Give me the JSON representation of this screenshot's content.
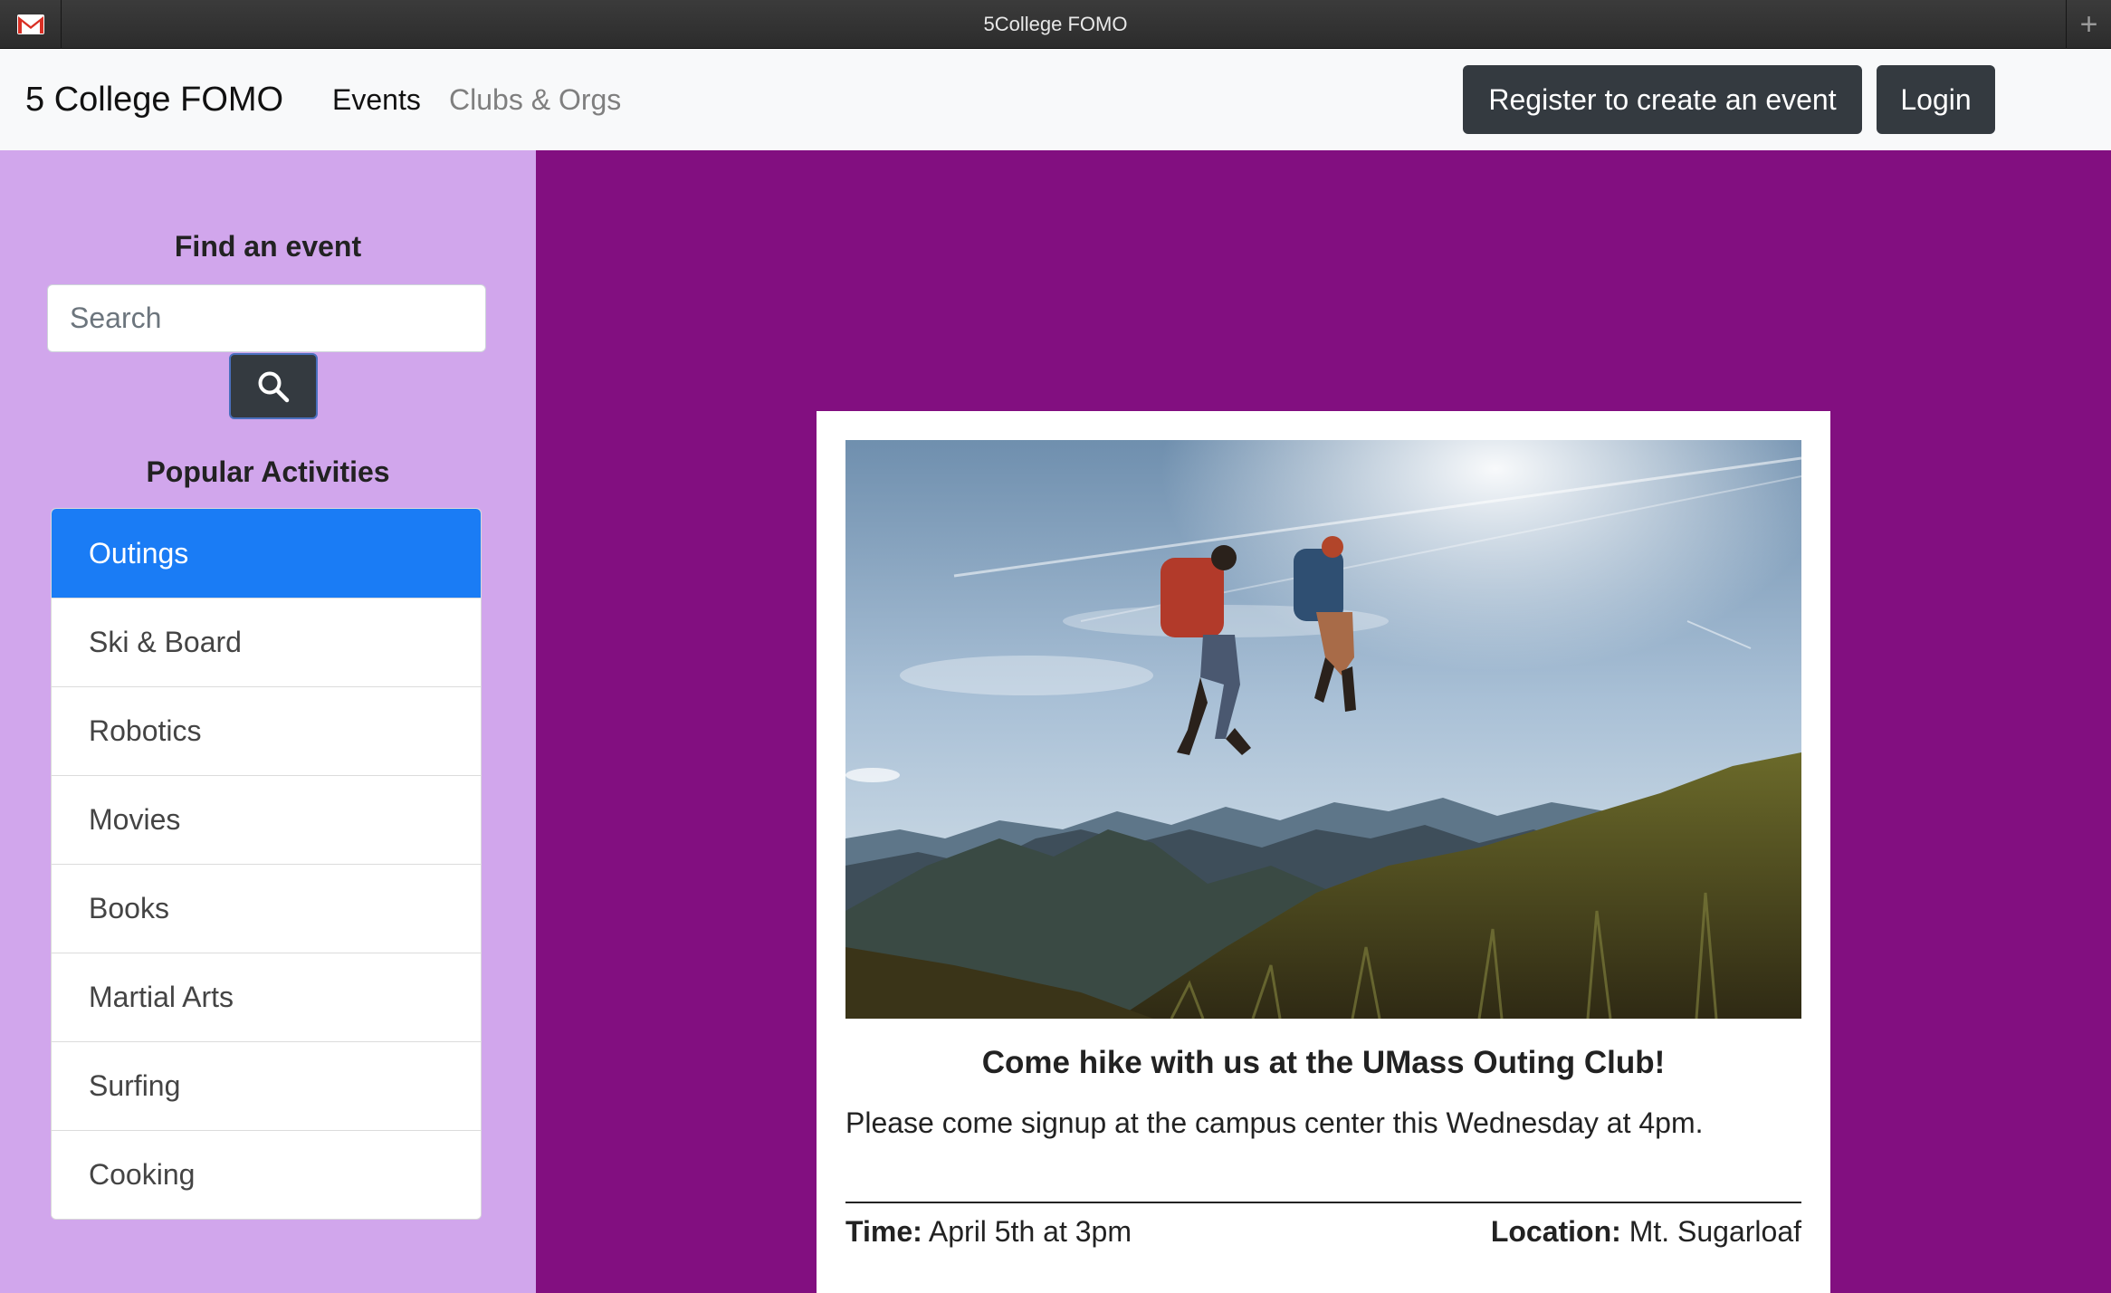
{
  "window": {
    "title": "5College FOMO",
    "app_icon": "gmail-envelope-icon",
    "new_tab_label": "+"
  },
  "navbar": {
    "brand": "5 College FOMO",
    "links": [
      {
        "label": "Events",
        "active": true
      },
      {
        "label": "Clubs & Orgs",
        "active": false
      }
    ],
    "register_label": "Register to create an event",
    "login_label": "Login"
  },
  "sidebar": {
    "find_heading": "Find an event",
    "search_placeholder": "Search",
    "search_icon": "search-icon",
    "popular_heading": "Popular Activities",
    "items": [
      {
        "label": "Outings",
        "active": true
      },
      {
        "label": "Ski & Board",
        "active": false
      },
      {
        "label": "Robotics",
        "active": false
      },
      {
        "label": "Movies",
        "active": false
      },
      {
        "label": "Books",
        "active": false
      },
      {
        "label": "Martial Arts",
        "active": false
      },
      {
        "label": "Surfing",
        "active": false
      },
      {
        "label": "Cooking",
        "active": false
      }
    ]
  },
  "event_card": {
    "title": "Come hike with us at the UMass Outing Club!",
    "description": "Please come signup at the campus center this Wednesday at 4pm.",
    "time_label": "Time:",
    "time_value": "April 5th at 3pm",
    "location_label": "Location:",
    "location_value": "Mt. Sugarloaf"
  },
  "colors": {
    "sidebar_bg": "#d1a6ec",
    "main_bg": "#820f80",
    "active_item": "#1a7cf5",
    "dark_button": "#343a40"
  }
}
